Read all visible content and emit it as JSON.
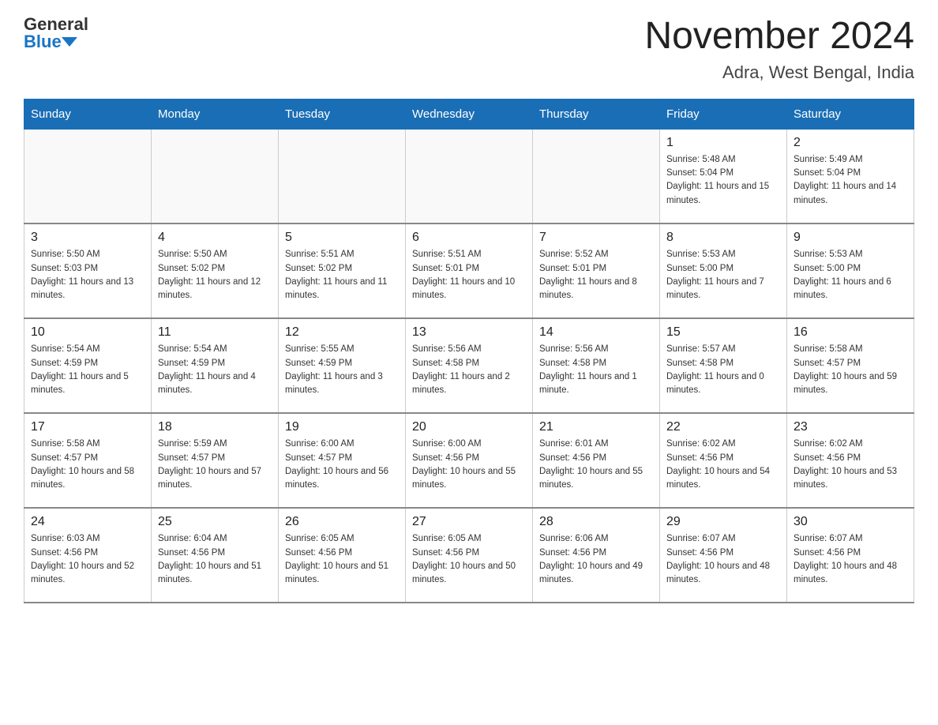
{
  "header": {
    "logo_general": "General",
    "logo_blue": "Blue",
    "title": "November 2024",
    "location": "Adra, West Bengal, India"
  },
  "days_of_week": [
    "Sunday",
    "Monday",
    "Tuesday",
    "Wednesday",
    "Thursday",
    "Friday",
    "Saturday"
  ],
  "weeks": [
    [
      {
        "day": "",
        "info": ""
      },
      {
        "day": "",
        "info": ""
      },
      {
        "day": "",
        "info": ""
      },
      {
        "day": "",
        "info": ""
      },
      {
        "day": "",
        "info": ""
      },
      {
        "day": "1",
        "info": "Sunrise: 5:48 AM\nSunset: 5:04 PM\nDaylight: 11 hours and 15 minutes."
      },
      {
        "day": "2",
        "info": "Sunrise: 5:49 AM\nSunset: 5:04 PM\nDaylight: 11 hours and 14 minutes."
      }
    ],
    [
      {
        "day": "3",
        "info": "Sunrise: 5:50 AM\nSunset: 5:03 PM\nDaylight: 11 hours and 13 minutes."
      },
      {
        "day": "4",
        "info": "Sunrise: 5:50 AM\nSunset: 5:02 PM\nDaylight: 11 hours and 12 minutes."
      },
      {
        "day": "5",
        "info": "Sunrise: 5:51 AM\nSunset: 5:02 PM\nDaylight: 11 hours and 11 minutes."
      },
      {
        "day": "6",
        "info": "Sunrise: 5:51 AM\nSunset: 5:01 PM\nDaylight: 11 hours and 10 minutes."
      },
      {
        "day": "7",
        "info": "Sunrise: 5:52 AM\nSunset: 5:01 PM\nDaylight: 11 hours and 8 minutes."
      },
      {
        "day": "8",
        "info": "Sunrise: 5:53 AM\nSunset: 5:00 PM\nDaylight: 11 hours and 7 minutes."
      },
      {
        "day": "9",
        "info": "Sunrise: 5:53 AM\nSunset: 5:00 PM\nDaylight: 11 hours and 6 minutes."
      }
    ],
    [
      {
        "day": "10",
        "info": "Sunrise: 5:54 AM\nSunset: 4:59 PM\nDaylight: 11 hours and 5 minutes."
      },
      {
        "day": "11",
        "info": "Sunrise: 5:54 AM\nSunset: 4:59 PM\nDaylight: 11 hours and 4 minutes."
      },
      {
        "day": "12",
        "info": "Sunrise: 5:55 AM\nSunset: 4:59 PM\nDaylight: 11 hours and 3 minutes."
      },
      {
        "day": "13",
        "info": "Sunrise: 5:56 AM\nSunset: 4:58 PM\nDaylight: 11 hours and 2 minutes."
      },
      {
        "day": "14",
        "info": "Sunrise: 5:56 AM\nSunset: 4:58 PM\nDaylight: 11 hours and 1 minute."
      },
      {
        "day": "15",
        "info": "Sunrise: 5:57 AM\nSunset: 4:58 PM\nDaylight: 11 hours and 0 minutes."
      },
      {
        "day": "16",
        "info": "Sunrise: 5:58 AM\nSunset: 4:57 PM\nDaylight: 10 hours and 59 minutes."
      }
    ],
    [
      {
        "day": "17",
        "info": "Sunrise: 5:58 AM\nSunset: 4:57 PM\nDaylight: 10 hours and 58 minutes."
      },
      {
        "day": "18",
        "info": "Sunrise: 5:59 AM\nSunset: 4:57 PM\nDaylight: 10 hours and 57 minutes."
      },
      {
        "day": "19",
        "info": "Sunrise: 6:00 AM\nSunset: 4:57 PM\nDaylight: 10 hours and 56 minutes."
      },
      {
        "day": "20",
        "info": "Sunrise: 6:00 AM\nSunset: 4:56 PM\nDaylight: 10 hours and 55 minutes."
      },
      {
        "day": "21",
        "info": "Sunrise: 6:01 AM\nSunset: 4:56 PM\nDaylight: 10 hours and 55 minutes."
      },
      {
        "day": "22",
        "info": "Sunrise: 6:02 AM\nSunset: 4:56 PM\nDaylight: 10 hours and 54 minutes."
      },
      {
        "day": "23",
        "info": "Sunrise: 6:02 AM\nSunset: 4:56 PM\nDaylight: 10 hours and 53 minutes."
      }
    ],
    [
      {
        "day": "24",
        "info": "Sunrise: 6:03 AM\nSunset: 4:56 PM\nDaylight: 10 hours and 52 minutes."
      },
      {
        "day": "25",
        "info": "Sunrise: 6:04 AM\nSunset: 4:56 PM\nDaylight: 10 hours and 51 minutes."
      },
      {
        "day": "26",
        "info": "Sunrise: 6:05 AM\nSunset: 4:56 PM\nDaylight: 10 hours and 51 minutes."
      },
      {
        "day": "27",
        "info": "Sunrise: 6:05 AM\nSunset: 4:56 PM\nDaylight: 10 hours and 50 minutes."
      },
      {
        "day": "28",
        "info": "Sunrise: 6:06 AM\nSunset: 4:56 PM\nDaylight: 10 hours and 49 minutes."
      },
      {
        "day": "29",
        "info": "Sunrise: 6:07 AM\nSunset: 4:56 PM\nDaylight: 10 hours and 48 minutes."
      },
      {
        "day": "30",
        "info": "Sunrise: 6:07 AM\nSunset: 4:56 PM\nDaylight: 10 hours and 48 minutes."
      }
    ]
  ]
}
